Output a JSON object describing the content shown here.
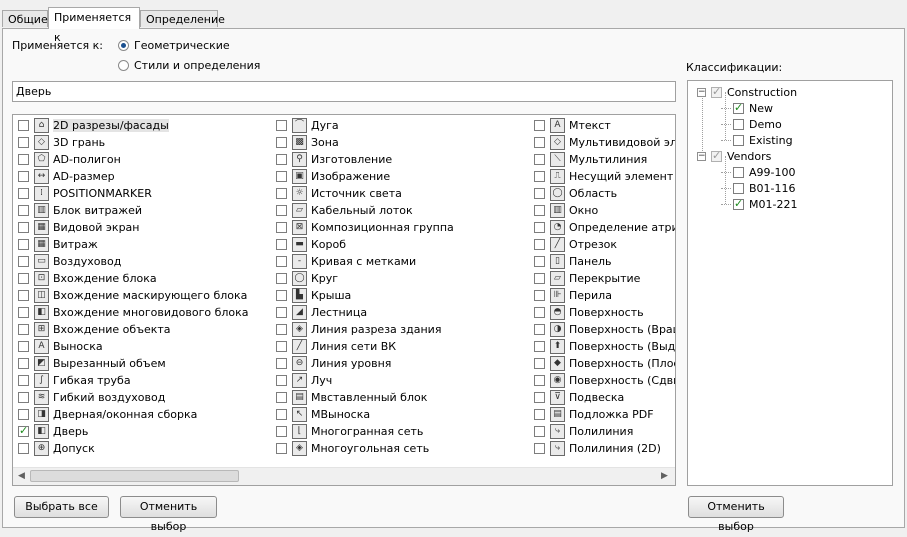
{
  "tabs": [
    "Общие",
    "Применяется к",
    "Определение"
  ],
  "applies_to": {
    "label": "Применяется к:",
    "options": [
      "Геометрические",
      "Стили и определения"
    ],
    "selected": "Геометрические"
  },
  "search": {
    "value": "Дверь"
  },
  "objects": {
    "col1": [
      {
        "label": "2D разрезы/фасады",
        "checked": false,
        "icon": "section-elevation-icon",
        "glyph": "⌂"
      },
      {
        "label": "3D грань",
        "checked": false,
        "icon": "3d-face-icon",
        "glyph": "◇"
      },
      {
        "label": "AD-полигон",
        "checked": false,
        "icon": "polygon-icon",
        "glyph": "⬠"
      },
      {
        "label": "AD-размер",
        "checked": false,
        "icon": "dimension-icon",
        "glyph": "↔"
      },
      {
        "label": "POSITIONMARKER",
        "checked": false,
        "icon": "position-marker-icon",
        "glyph": "⁞"
      },
      {
        "label": "Блок витражей",
        "checked": false,
        "icon": "curtain-wall-unit-icon",
        "glyph": "▥"
      },
      {
        "label": "Видовой экран",
        "checked": false,
        "icon": "viewport-icon",
        "glyph": "▦"
      },
      {
        "label": "Витраж",
        "checked": false,
        "icon": "curtain-wall-icon",
        "glyph": "▦"
      },
      {
        "label": "Воздуховод",
        "checked": false,
        "icon": "duct-icon",
        "glyph": "▭"
      },
      {
        "label": "Вхождение блока",
        "checked": false,
        "icon": "block-reference-icon",
        "glyph": "⊡"
      },
      {
        "label": "Вхождение маскирующего блока",
        "checked": false,
        "icon": "mask-block-icon",
        "glyph": "◫"
      },
      {
        "label": "Вхождение многовидового блока",
        "checked": false,
        "icon": "mv-block-icon",
        "glyph": "◧"
      },
      {
        "label": "Вхождение объекта",
        "checked": false,
        "icon": "object-reference-icon",
        "glyph": "⊞"
      },
      {
        "label": "Выноска",
        "checked": false,
        "icon": "leader-icon",
        "glyph": "A"
      },
      {
        "label": "Вырезанный объем",
        "checked": false,
        "icon": "cut-volume-icon",
        "glyph": "◩"
      },
      {
        "label": "Гибкая труба",
        "checked": false,
        "icon": "flex-pipe-icon",
        "glyph": "∫"
      },
      {
        "label": "Гибкий воздуховод",
        "checked": false,
        "icon": "flex-duct-icon",
        "glyph": "≋"
      },
      {
        "label": "Дверная/оконная сборка",
        "checked": false,
        "icon": "door-window-assembly-icon",
        "glyph": "◨"
      },
      {
        "label": "Дверь",
        "checked": true,
        "icon": "door-icon",
        "glyph": "◧"
      },
      {
        "label": "Допуск",
        "checked": false,
        "icon": "tolerance-icon",
        "glyph": "⊕"
      }
    ],
    "col2": [
      {
        "label": "Дуга",
        "checked": false,
        "icon": "arc-icon",
        "glyph": "⌒"
      },
      {
        "label": "Зона",
        "checked": false,
        "icon": "zone-icon",
        "glyph": "▩"
      },
      {
        "label": "Изготовление",
        "checked": false,
        "icon": "fabrication-icon",
        "glyph": "⚲"
      },
      {
        "label": "Изображение",
        "checked": false,
        "icon": "image-icon",
        "glyph": "▣"
      },
      {
        "label": "Источник света",
        "checked": false,
        "icon": "light-source-icon",
        "glyph": "☼"
      },
      {
        "label": "Кабельный лоток",
        "checked": false,
        "icon": "cable-tray-icon",
        "glyph": "▱"
      },
      {
        "label": "Композиционная группа",
        "checked": false,
        "icon": "composition-group-icon",
        "glyph": "⊠"
      },
      {
        "label": "Короб",
        "checked": false,
        "icon": "conduit-icon",
        "glyph": "▬"
      },
      {
        "label": "Кривая с метками",
        "checked": false,
        "icon": "labeled-curve-icon",
        "glyph": "‐"
      },
      {
        "label": "Круг",
        "checked": false,
        "icon": "circle-icon",
        "glyph": "◯"
      },
      {
        "label": "Крыша",
        "checked": false,
        "icon": "roof-icon",
        "glyph": "▙"
      },
      {
        "label": "Лестница",
        "checked": false,
        "icon": "stair-icon",
        "glyph": "◢"
      },
      {
        "label": "Линия разреза здания",
        "checked": false,
        "icon": "section-line-icon",
        "glyph": "◈"
      },
      {
        "label": "Линия сети ВК",
        "checked": false,
        "icon": "plumbing-line-icon",
        "glyph": "╱"
      },
      {
        "label": "Линия уровня",
        "checked": false,
        "icon": "level-line-icon",
        "glyph": "⊖"
      },
      {
        "label": "Луч",
        "checked": false,
        "icon": "ray-icon",
        "glyph": "↗"
      },
      {
        "label": "Мвставленный блок",
        "checked": false,
        "icon": "embedded-block-icon",
        "glyph": "▤"
      },
      {
        "label": "МВыноска",
        "checked": false,
        "icon": "mleader-icon",
        "glyph": "↖"
      },
      {
        "label": "Многогранная сеть",
        "checked": false,
        "icon": "polyface-mesh-icon",
        "glyph": "⌊"
      },
      {
        "label": "Многоугольная сеть",
        "checked": false,
        "icon": "polygon-mesh-icon",
        "glyph": "◈"
      }
    ],
    "col3": [
      {
        "label": "Мтекст",
        "checked": false,
        "icon": "mtext-icon",
        "glyph": "A"
      },
      {
        "label": "Мультивидовой элем",
        "checked": false,
        "icon": "multiview-element-icon",
        "glyph": "◇"
      },
      {
        "label": "Мультилиния",
        "checked": false,
        "icon": "multiline-icon",
        "glyph": "⟍"
      },
      {
        "label": "Несущий элемент",
        "checked": false,
        "icon": "structural-member-icon",
        "glyph": "⎍"
      },
      {
        "label": "Область",
        "checked": false,
        "icon": "region-icon",
        "glyph": "◯"
      },
      {
        "label": "Окно",
        "checked": false,
        "icon": "window-icon",
        "glyph": "▥"
      },
      {
        "label": "Определение атрибу",
        "checked": false,
        "icon": "attribute-definition-icon",
        "glyph": "◔"
      },
      {
        "label": "Отрезок",
        "checked": false,
        "icon": "line-icon",
        "glyph": "╱"
      },
      {
        "label": "Панель",
        "checked": false,
        "icon": "panel-icon",
        "glyph": "▯"
      },
      {
        "label": "Перекрытие",
        "checked": false,
        "icon": "slab-icon",
        "glyph": "▱"
      },
      {
        "label": "Перила",
        "checked": false,
        "icon": "railing-icon",
        "glyph": "⊪"
      },
      {
        "label": "Поверхность",
        "checked": false,
        "icon": "surface-icon",
        "glyph": "◓"
      },
      {
        "label": "Поверхность (Враще",
        "checked": false,
        "icon": "revolved-surface-icon",
        "glyph": "◑"
      },
      {
        "label": "Поверхность (Выдав",
        "checked": false,
        "icon": "extruded-surface-icon",
        "glyph": "⬆"
      },
      {
        "label": "Поверхность (Плоска",
        "checked": false,
        "icon": "planar-surface-icon",
        "glyph": "◆"
      },
      {
        "label": "Поверхность (Сдвиг)",
        "checked": false,
        "icon": "swept-surface-icon",
        "glyph": "◉"
      },
      {
        "label": "Подвеска",
        "checked": false,
        "icon": "hanger-icon",
        "glyph": "⊽"
      },
      {
        "label": "Подложка PDF",
        "checked": false,
        "icon": "pdf-underlay-icon",
        "glyph": "▤"
      },
      {
        "label": "Полилиния",
        "checked": false,
        "icon": "polyline-icon",
        "glyph": "⤷"
      },
      {
        "label": "Полилиния (2D)",
        "checked": false,
        "icon": "polyline-2d-icon",
        "glyph": "⤷"
      }
    ]
  },
  "buttons": {
    "select_all": "Выбрать все",
    "clear_selection": "Отменить выбор",
    "clear_classification": "Отменить выбор"
  },
  "classifications": {
    "label": "Классификации:",
    "tree": [
      {
        "label": "Construction",
        "level": 0,
        "expander": "−",
        "check": "gray"
      },
      {
        "label": "New",
        "level": 1,
        "check": "on"
      },
      {
        "label": "Demo",
        "level": 1,
        "check": "off"
      },
      {
        "label": "Existing",
        "level": 1,
        "check": "off"
      },
      {
        "label": "Vendors",
        "level": 0,
        "expander": "−",
        "check": "gray"
      },
      {
        "label": "A99-100",
        "level": 1,
        "check": "off"
      },
      {
        "label": "B01-116",
        "level": 1,
        "check": "off"
      },
      {
        "label": "M01-221",
        "level": 1,
        "check": "on"
      }
    ]
  },
  "colors": {
    "check_green": "#1c8a1c",
    "radio_blue": "#1a4f8f"
  }
}
